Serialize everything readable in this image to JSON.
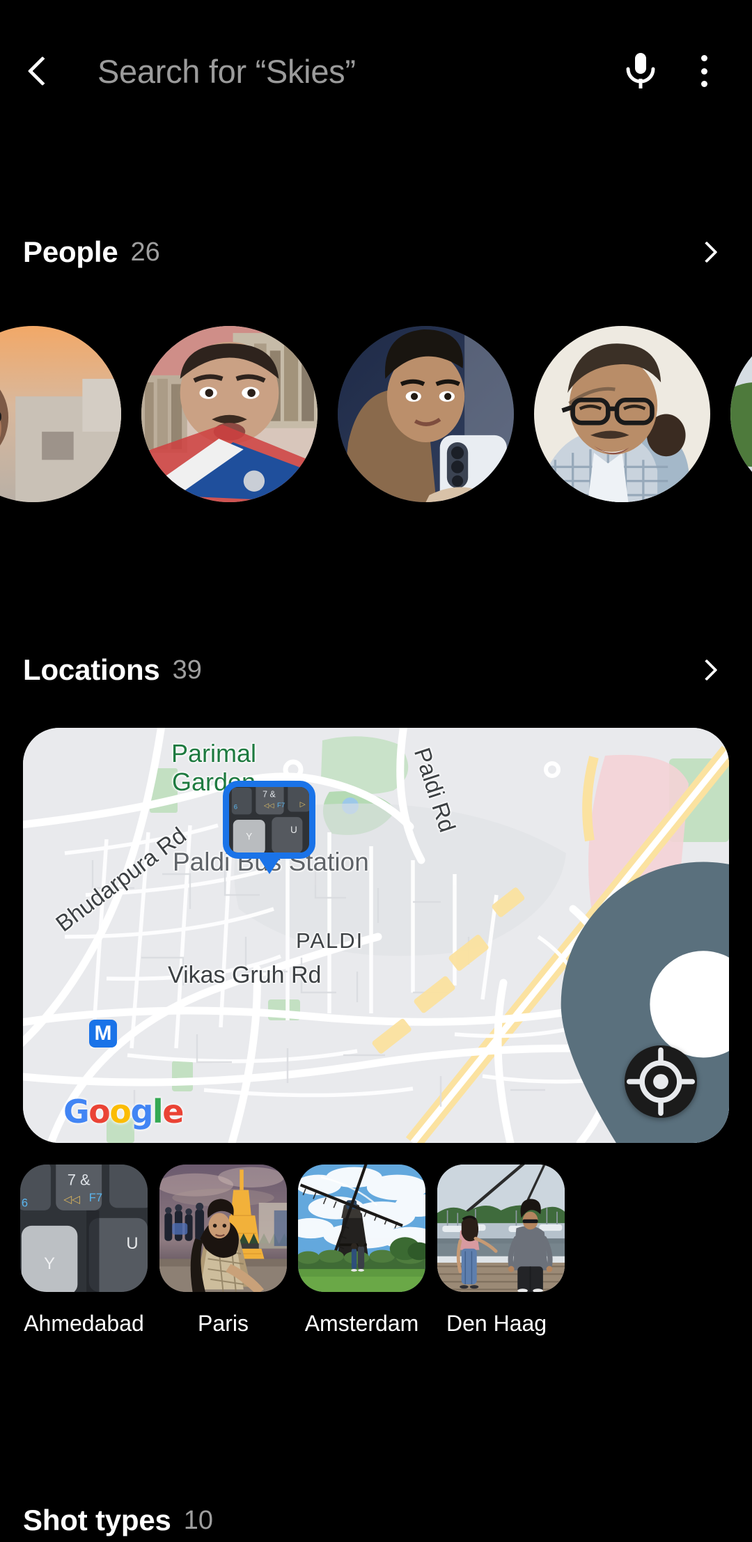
{
  "app": {
    "background_color": "#000000",
    "accent_color": "#1a73e8"
  },
  "topbar": {
    "back_icon": "chevron-left-icon",
    "search_placeholder": "Search for “Skies”",
    "search_value": "",
    "mic_icon": "microphone-icon",
    "overflow_icon": "more-vertical-icon"
  },
  "sections": {
    "people": {
      "title": "People",
      "count": "26",
      "chevron_icon": "chevron-right-icon",
      "avatars": [
        {
          "name": "person-avatar-1",
          "alt": "man with glasses on rooftop at sunset"
        },
        {
          "name": "person-avatar-2",
          "alt": "man with moustache in front of bookshelf"
        },
        {
          "name": "person-avatar-3",
          "alt": "young man holding a phone"
        },
        {
          "name": "person-avatar-4",
          "alt": "older man with glasses smiling"
        },
        {
          "name": "person-avatar-5",
          "alt": "man in pink shirt outdoors"
        }
      ]
    },
    "locations": {
      "title": "Locations",
      "count": "39",
      "chevron_icon": "chevron-right-icon",
      "map": {
        "provider_logo": "Google",
        "provider_letters": [
          "G",
          "o",
          "o",
          "g",
          "l",
          "e"
        ],
        "my_location_icon": "my-location-icon",
        "photo_marker_alt": "keyboard keys close-up",
        "pin_icon": "map-pin-icon",
        "metro_marker_label": "M",
        "labels": [
          {
            "name": "map-label-parimal-garden",
            "text_line1": "Parimal",
            "text_line2": "Garden",
            "color": "#1e7a40"
          },
          {
            "name": "map-label-paldi-rd",
            "text": "Paldi Rd"
          },
          {
            "name": "map-label-bhudarpura-rd",
            "text": "Bhudarpura Rd"
          },
          {
            "name": "map-label-paldi-bus-station",
            "text": "Paldi Bus Station"
          },
          {
            "name": "map-label-paldi",
            "text": "PALDI"
          },
          {
            "name": "map-label-vikas-gruh-rd",
            "text": "Vikas Gruh Rd"
          }
        ]
      },
      "thumbnails": [
        {
          "label": "Ahmedabad",
          "alt": "close-up of keyboard Y and U keys"
        },
        {
          "label": "Paris",
          "alt": "woman in front of Eiffel Tower at night"
        },
        {
          "label": "Amsterdam",
          "alt": "couple in front of a windmill"
        },
        {
          "label": "Den Haag",
          "alt": "couple walking on a dock by the water"
        }
      ]
    },
    "shot_types": {
      "title": "Shot types",
      "count": "10"
    }
  }
}
